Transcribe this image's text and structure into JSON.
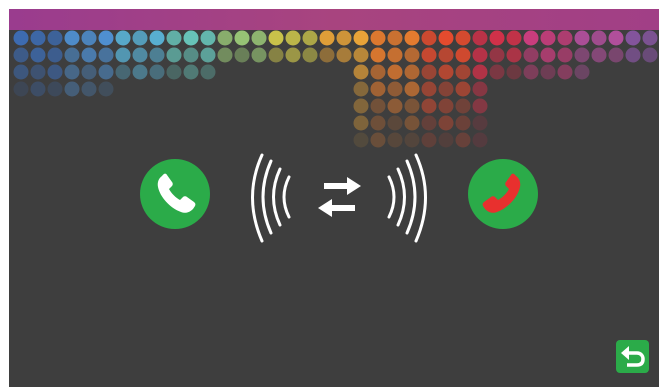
{
  "screen": {
    "title": "",
    "status_text": ""
  },
  "colors": {
    "background": "#3e3e3e",
    "top_bar": "#a0418a",
    "accent_green": "#2bab49",
    "reject_handset": "#e8302e",
    "icon_white": "#ffffff"
  },
  "icons": {
    "accept": "phone-accept-icon",
    "signal": "call-transfer-signal-icon",
    "reject": "phone-reject-icon",
    "back": "back-arrow-icon"
  },
  "mosaic_palette": [
    "#3d6bb0",
    "#4f8fd0",
    "#5ab4d8",
    "#67c3b8",
    "#9bc978",
    "#c9c24a",
    "#e8a338",
    "#ec7e2e",
    "#e44b2e",
    "#d8304a",
    "#c93d7d",
    "#b04f9b",
    "#8b57a6"
  ]
}
